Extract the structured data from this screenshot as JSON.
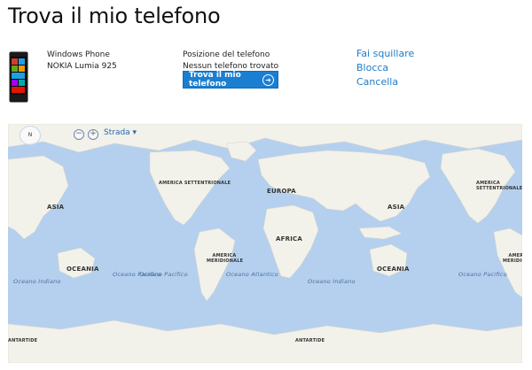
{
  "page": {
    "title": "Trova il mio telefono"
  },
  "device": {
    "type": "Windows Phone",
    "model": "NOKIA Lumia 925"
  },
  "location": {
    "title": "Posizione del telefono",
    "status": "Nessun telefono trovato",
    "button_label": "Trova il mio telefono"
  },
  "actions": [
    {
      "label": "Fai squillare"
    },
    {
      "label": "Blocca"
    },
    {
      "label": "Cancella"
    }
  ],
  "map": {
    "compass_label": "N",
    "zoom_out": "−",
    "zoom_in": "+",
    "style_label": "Strada ▾",
    "labels": {
      "asia_left": "ASIA",
      "na_center": "AMERICA SETTENTRIONALE",
      "europa": "EUROPA",
      "africa": "AFRICA",
      "asia_center": "ASIA",
      "na_right": "AMERICA SETTENTRIONALE",
      "oceania_left": "OCEANIA",
      "sa_center": "AMERICA MERIDIONALE",
      "oceania_center": "OCEANIA",
      "sa_right": "AMERICA MERIDIONALE",
      "oceano_indiano_left": "Oceano Indiano",
      "oceano_pacifico_left": "Oceano Pacifico",
      "oceano_pacifico_center": "Oceano Pacifico",
      "oceano_atlantico": "Oceano Atlantico",
      "oceano_indiano_center": "Oceano Indiano",
      "oceano_pacifico_right": "Oceano Pacifico",
      "antartide_left": "ANTARTIDE",
      "antartide_center": "ANTARTIDE"
    }
  },
  "colors": {
    "accent": "#1a7fd1",
    "link": "#1e7bc8",
    "ocean": "#b5d0ee",
    "land": "#f2f1ea"
  }
}
